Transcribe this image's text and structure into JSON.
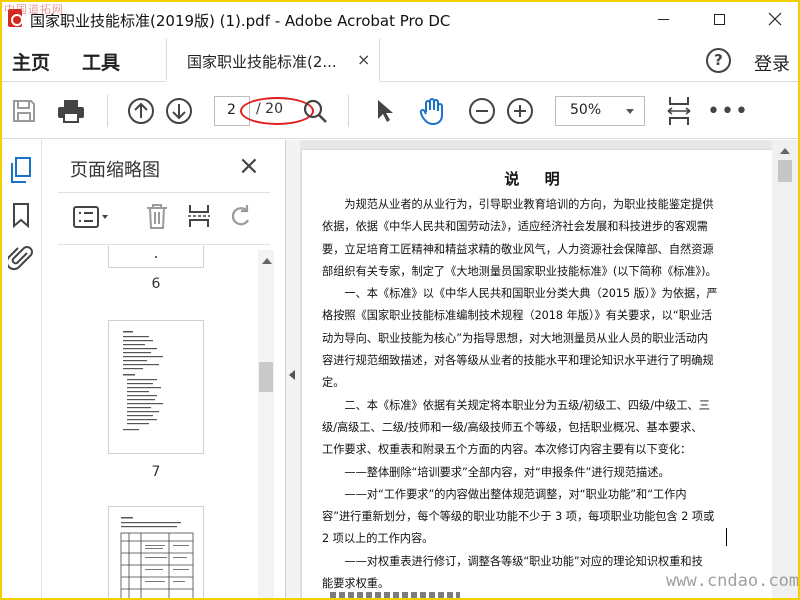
{
  "window": {
    "title": "国家职业技能标准(2019版) (1).pdf - Adobe Acrobat Pro DC",
    "watermark_top": "中国道拓网"
  },
  "tabs": {
    "home": "主页",
    "tools": "工具",
    "document_tab": "国家职业技能标准(2...",
    "close": "×",
    "help": "?",
    "login": "登录"
  },
  "toolbar": {
    "page_current": "2",
    "page_total": "/ 20",
    "zoom": "50%",
    "more": "•••"
  },
  "panel": {
    "title": "页面缩略图",
    "close": "×",
    "thumbnails": [
      {
        "number": "6"
      },
      {
        "number": "7"
      }
    ]
  },
  "document": {
    "title": "说 明",
    "lines": [
      "　　为规范从业者的从业行为，引导职业教育培训的方向，为职业技能鉴定提供",
      "依据，依据《中华人民共和国劳动法》，适应经济社会发展和科技进步的客观需",
      "要，立足培育工匠精神和精益求精的敬业风气，人力资源社会保障部、自然资源",
      "部组织有关专家，制定了《大地测量员国家职业技能标准》(以下简称《标准》)。",
      "　　一、本《标准》以《中华人民共和国职业分类大典（2015 版）》为依据，严",
      "格按照《国家职业技能标准编制技术规程（2018 年版）》有关要求，以“职业活",
      "动为导向、职业技能为核心”为指导思想，对大地测量员从业人员的职业活动内",
      "容进行规范细致描述，对各等级从业者的技能水平和理论知识水平进行了明确规",
      "定。",
      "　　二、本《标准》依据有关规定将本职业分为五级/初级工、四级/中级工、三",
      "级/高级工、二级/技师和一级/高级技师五个等级，包括职业概况、基本要求、",
      "工作要求、权重表和附录五个方面的内容。本次修订内容主要有以下变化：",
      "　　——整体删除“培训要求”全部内容，对“申报条件”进行规范描述。",
      "　　——对“工作要求”的内容做出整体规范调整，对“职业功能”和“工作内",
      "容”进行重新划分，每个等级的职业功能不少于 3 项，每项职业功能包含 2 项或",
      "2 项以上的工作内容。",
      "　　——对权重表进行修订，调整各等级“职业功能”对应的理论知识权重和技",
      "能要求权重。"
    ],
    "watermark_bottom": "www.cndao.com"
  }
}
